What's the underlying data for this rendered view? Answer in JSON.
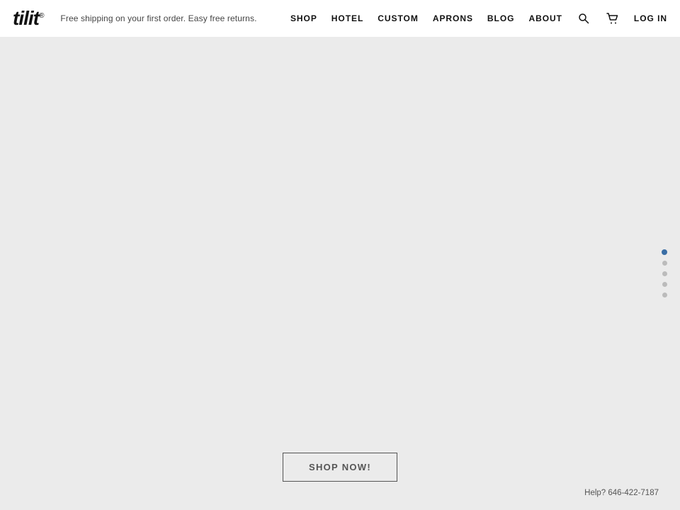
{
  "header": {
    "logo": "tilit",
    "logo_registered": "®",
    "tagline": "Free shipping on your first order. Easy free returns.",
    "nav": {
      "items": [
        {
          "label": "SHOP",
          "id": "shop"
        },
        {
          "label": "HOTEL",
          "id": "hotel"
        },
        {
          "label": "CUSTOM",
          "id": "custom"
        },
        {
          "label": "APRONS",
          "id": "aprons"
        },
        {
          "label": "BLOG",
          "id": "blog"
        },
        {
          "label": "ABOUT",
          "id": "about"
        }
      ]
    },
    "login_label": "LOG IN"
  },
  "slide_dots": {
    "count": 5,
    "active_index": 0
  },
  "main": {
    "shop_now_label": "SHOP NOW!",
    "help_text": "Help? 646-422-7187"
  }
}
